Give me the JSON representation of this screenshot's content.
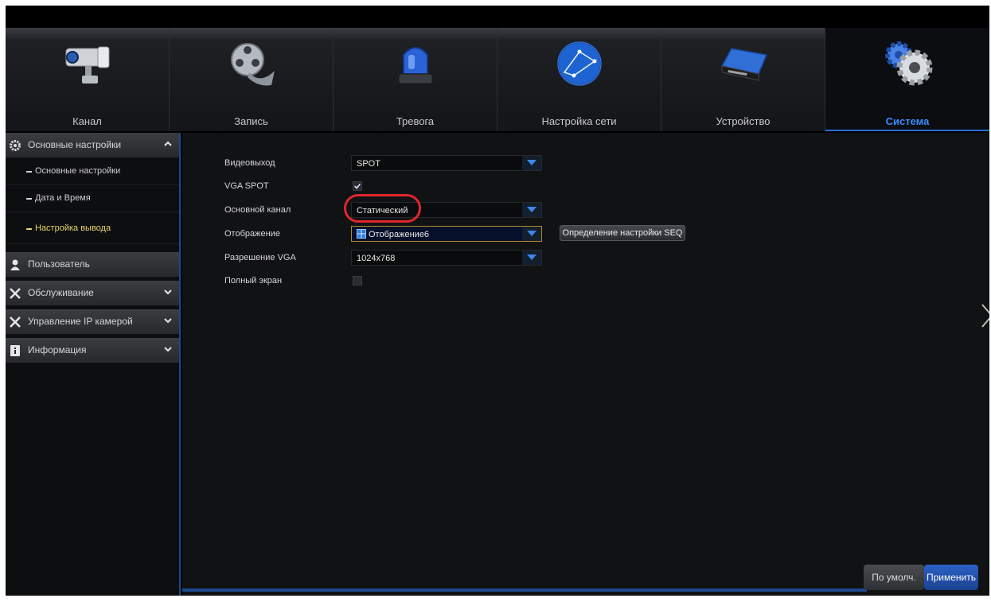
{
  "tabs": [
    {
      "label": "Канал",
      "icon": "camera-icon"
    },
    {
      "label": "Запись",
      "icon": "film-reel-icon"
    },
    {
      "label": "Тревога",
      "icon": "alarm-light-icon"
    },
    {
      "label": "Настройка сети",
      "icon": "globe-icon"
    },
    {
      "label": "Устройство",
      "icon": "hard-drive-icon"
    },
    {
      "label": "Система",
      "icon": "gears-icon",
      "active": true
    }
  ],
  "sidebar": {
    "basic": {
      "label": "Основные настройки",
      "icon": "gear-icon",
      "expanded": true
    },
    "subitems": [
      {
        "label": "Основные настройки"
      },
      {
        "label": "Дата и Время"
      },
      {
        "label": "Настройка вывода",
        "active": true
      }
    ],
    "user": {
      "label": "Пользователь",
      "icon": "user-icon"
    },
    "maintenance": {
      "label": "Обслуживание",
      "icon": "tools-icon"
    },
    "ipcam": {
      "label": "Управление IP камерой",
      "icon": "tools-icon"
    },
    "info": {
      "label": "Информация",
      "icon": "info-book-icon"
    }
  },
  "form": {
    "video_out": {
      "label": "Видеовыход",
      "value": "SPOT"
    },
    "vga_spot": {
      "label": "VGA SPOT",
      "checked": true
    },
    "main_channel": {
      "label": "Основной канал",
      "value": "Статический"
    },
    "display": {
      "label": "Отображение",
      "value": "Отображение6",
      "button": "Определение настройки SEQ"
    },
    "vga_resolution": {
      "label": "Разрешение VGA",
      "value": "1024x768"
    },
    "fullscreen": {
      "label": "Полный экран",
      "checked": false
    }
  },
  "footer": {
    "default_label": "По умолч.",
    "apply_label": "Применить"
  },
  "colors": {
    "accent": "#3d8cff",
    "active_sub": "#e6d36a",
    "highlight_circle": "#e0262b"
  }
}
